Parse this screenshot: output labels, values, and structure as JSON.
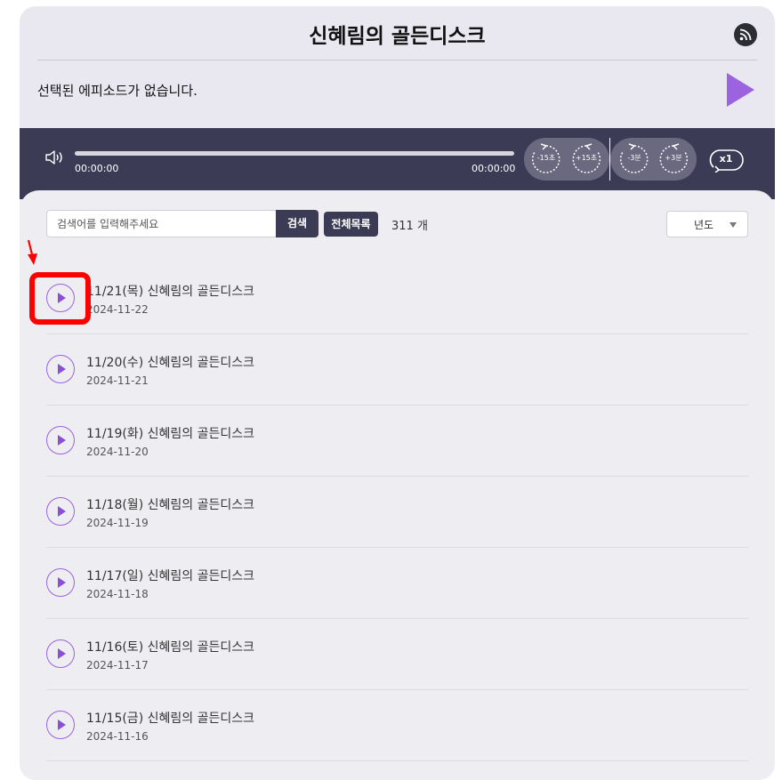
{
  "header": {
    "title": "신혜림의 골든디스크",
    "no_episode_text": "선택된 에피소드가 없습니다."
  },
  "player": {
    "current_time": "00:00:00",
    "duration": "00:00:00",
    "skip_back_15": "-15초",
    "skip_fwd_15": "+15초",
    "skip_back_3m": "-3분",
    "skip_fwd_3m": "+3분",
    "speed": "x1"
  },
  "search": {
    "placeholder": "검색어를 입력해주세요",
    "search_button": "검색",
    "all_list_button": "전체목록",
    "count": "311 개",
    "year_select": "년도"
  },
  "episodes": [
    {
      "title": "11/21(목) 신혜림의 골든디스크",
      "date": "2024-11-22"
    },
    {
      "title": "11/20(수) 신혜림의 골든디스크",
      "date": "2024-11-21"
    },
    {
      "title": "11/19(화) 신혜림의 골든디스크",
      "date": "2024-11-20"
    },
    {
      "title": "11/18(월) 신혜림의 골든디스크",
      "date": "2024-11-19"
    },
    {
      "title": "11/17(일) 신혜림의 골든디스크",
      "date": "2024-11-18"
    },
    {
      "title": "11/16(토) 신혜림의 골든디스크",
      "date": "2024-11-17"
    },
    {
      "title": "11/15(금) 신혜림의 골든디스크",
      "date": "2024-11-16"
    }
  ],
  "icons": {
    "rss": "rss-icon",
    "play": "play-icon",
    "volume": "volume-icon"
  },
  "colors": {
    "accent": "#9b63e0",
    "player_bg": "#3c3b56",
    "annotation": "#ff0000"
  }
}
